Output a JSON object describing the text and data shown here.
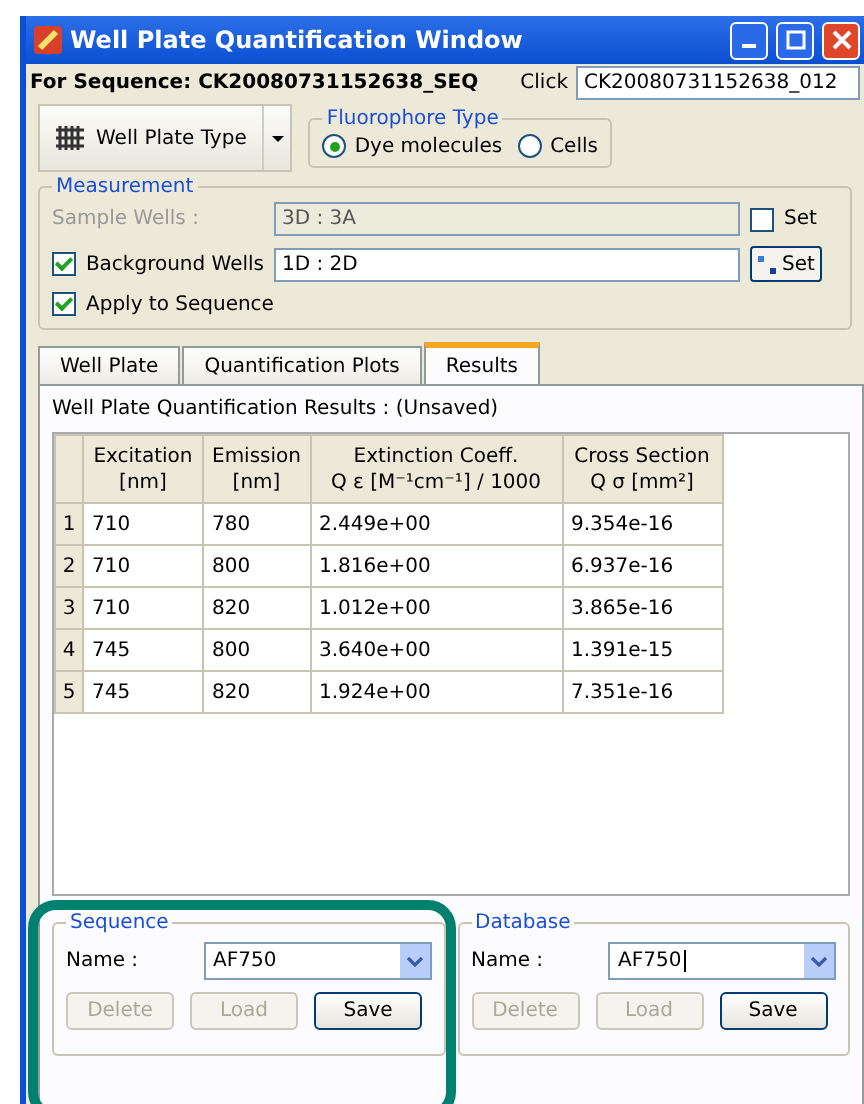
{
  "window": {
    "title": "Well Plate Quantification Window"
  },
  "sequence_label": "For Sequence: CK20080731152638_SEQ",
  "click": {
    "label": "Click",
    "value": "CK20080731152638_012"
  },
  "plate_type_button": "Well Plate Type",
  "fluorophore": {
    "title": "Fluorophore Type",
    "options": [
      {
        "label": "Dye molecules",
        "selected": true
      },
      {
        "label": "Cells",
        "selected": false
      }
    ]
  },
  "measurement": {
    "title": "Measurement",
    "sample_wells": {
      "label": "Sample Wells :",
      "value": "3D : 3A",
      "disabled": true,
      "set_label": "Set",
      "set_checked": false
    },
    "background_wells": {
      "label": "Background Wells",
      "checked": true,
      "value": "1D : 2D",
      "set_label": "Set"
    },
    "apply": {
      "label": "Apply to Sequence",
      "checked": true
    }
  },
  "tabs": [
    {
      "label": "Well Plate",
      "selected": false
    },
    {
      "label": "Quantification Plots",
      "selected": false
    },
    {
      "label": "Results",
      "selected": true
    }
  ],
  "results": {
    "title": "Well Plate Quantification Results : (Unsaved)",
    "columns": [
      {
        "line1": "Excitation",
        "line2": "[nm]"
      },
      {
        "line1": "Emission",
        "line2": "[nm]"
      },
      {
        "line1": "Extinction Coeff.",
        "line2": "Q ε [M⁻¹cm⁻¹] / 1000"
      },
      {
        "line1": "Cross Section",
        "line2": "Q σ [mm²]"
      }
    ],
    "rows": [
      {
        "index": "1",
        "cells": [
          "710",
          "780",
          "2.449e+00",
          "9.354e-16"
        ]
      },
      {
        "index": "2",
        "cells": [
          "710",
          "800",
          "1.816e+00",
          "6.937e-16"
        ]
      },
      {
        "index": "3",
        "cells": [
          "710",
          "820",
          "1.012e+00",
          "3.865e-16"
        ]
      },
      {
        "index": "4",
        "cells": [
          "745",
          "800",
          "3.640e+00",
          "1.391e-15"
        ]
      },
      {
        "index": "5",
        "cells": [
          "745",
          "820",
          "1.924e+00",
          "7.351e-16"
        ]
      }
    ]
  },
  "panels": [
    {
      "title": "Sequence",
      "highlighted": true,
      "name_label": "Name :",
      "name_value": "AF750",
      "buttons": [
        {
          "label": "Delete",
          "disabled": true
        },
        {
          "label": "Load",
          "disabled": true
        },
        {
          "label": "Save",
          "disabled": false
        }
      ]
    },
    {
      "title": "Database",
      "highlighted": false,
      "name_label": "Name :",
      "name_value": "AF750",
      "buttons": [
        {
          "label": "Delete",
          "disabled": true
        },
        {
          "label": "Load",
          "disabled": true
        },
        {
          "label": "Save",
          "disabled": false
        }
      ]
    }
  ]
}
